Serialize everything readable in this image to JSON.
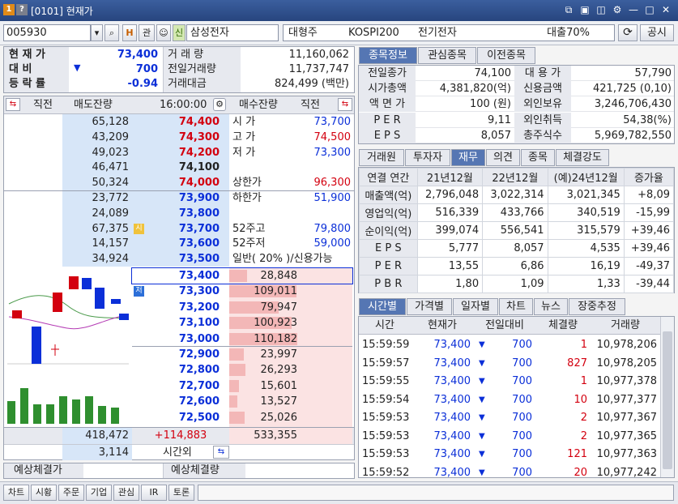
{
  "window": {
    "num1": "1",
    "num2": "?",
    "title": "[0101] 현재가"
  },
  "toolbar": {
    "code": "005930",
    "search_label": "⌕",
    "h_label": "H",
    "gwan_label": "관",
    "sin_label": "신",
    "stock_name": "삼성전자",
    "size_class": "대형주",
    "index": "KOSPI200",
    "sector": "전기전자",
    "loan": "대출70%",
    "refresh_label": "⟳",
    "notice_label": "공시"
  },
  "summary": {
    "rows": [
      {
        "label": "현 재 가",
        "value": "73,400"
      },
      {
        "label": "대    비",
        "arrow": "▼",
        "value": "700"
      },
      {
        "label": "등 락 률",
        "value": "-0.94"
      }
    ],
    "vol_rows": [
      {
        "label": "거 래 량",
        "value": "11,160,062"
      },
      {
        "label": "전일거래량",
        "value": "11,737,747"
      },
      {
        "label": "거래대금",
        "value": "824,499 (백만)"
      }
    ]
  },
  "orderbook": {
    "headers": {
      "prev": "직전",
      "ask": "매도잔량",
      "time": "16:00:00",
      "bid": "매수잔량",
      "prev2": "직전"
    },
    "asks": [
      {
        "qty": "65,128",
        "price": "74,400",
        "info_label": "시    가",
        "info_value": "73,700"
      },
      {
        "qty": "43,209",
        "price": "74,300",
        "info_label": "고    가",
        "info_value": "74,500"
      },
      {
        "qty": "49,023",
        "price": "74,200",
        "info_label": "저    가",
        "info_value": "73,300"
      },
      {
        "qty": "46,471",
        "price": "74,100",
        "info_label": "",
        "info_value": ""
      },
      {
        "qty": "50,324",
        "price": "74,000",
        "info_label": "상한가",
        "info_value": "96,300"
      },
      {
        "qty": "23,772",
        "price": "73,900",
        "info_label": "하한가",
        "info_value": "51,900"
      },
      {
        "qty": "24,089",
        "price": "73,800",
        "info_label": "",
        "info_value": ""
      },
      {
        "qty": "67,375",
        "price": "73,700",
        "info_label": "52주고",
        "info_value": "79,800",
        "tag": "시"
      },
      {
        "qty": "14,157",
        "price": "73,600",
        "info_label": "52주저",
        "info_value": "59,000"
      },
      {
        "qty": "34,924",
        "price": "73,500",
        "info_label": "일반( 20% )/신용가능",
        "info_value": ""
      }
    ],
    "bids": [
      {
        "price": "73,400",
        "qty": "28,848",
        "bar": 0.26
      },
      {
        "price": "73,300",
        "qty": "109,011",
        "bar": 0.99,
        "tag": "저"
      },
      {
        "price": "73,200",
        "qty": "79,947",
        "bar": 0.73
      },
      {
        "price": "73,100",
        "qty": "100,923",
        "bar": 0.92
      },
      {
        "price": "73,000",
        "qty": "110,182",
        "bar": 1.0
      },
      {
        "price": "72,900",
        "qty": "23,997",
        "bar": 0.22
      },
      {
        "price": "72,800",
        "qty": "26,293",
        "bar": 0.24
      },
      {
        "price": "72,700",
        "qty": "15,601",
        "bar": 0.14
      },
      {
        "price": "72,600",
        "qty": "13,527",
        "bar": 0.12
      },
      {
        "price": "72,500",
        "qty": "25,026",
        "bar": 0.23
      }
    ],
    "total_ask": "418,472",
    "diff": "+114,883",
    "total_bid": "533,355",
    "after_qty": "3,114",
    "after_label": "시간외",
    "expected_price_label": "예상체결가",
    "expected_qty_label": "예상체결량"
  },
  "bottom_buttons": [
    "차트",
    "시황",
    "주문",
    "기업",
    "관심",
    "IR",
    "토론"
  ],
  "info_tabs": [
    "종목정보",
    "관심종목",
    "이전종목"
  ],
  "stock_info": [
    {
      "l1": "전일종가",
      "v1": "74,100",
      "l2": "대 용 가",
      "v2": "57,790"
    },
    {
      "l1": "시가총액",
      "v1": "4,381,820(억)",
      "l2": "신용금액",
      "v2": "421,725  (0,10)"
    },
    {
      "l1": "액 면 가",
      "v1": "100 (원)",
      "l2": "외인보유",
      "v2": "3,246,706,430"
    },
    {
      "l1": "P E R",
      "v1": "9,11",
      "l2": "외인취득",
      "v2": "54,38(%)"
    },
    {
      "l1": "E P S",
      "v1": "8,057",
      "l2": "총주식수",
      "v2": "5,969,782,550"
    }
  ],
  "fin_tabs": [
    "거래원",
    "투자자",
    "재무",
    "의견",
    "종목",
    "체결강도"
  ],
  "fin_table": {
    "headers": [
      "연결 연간",
      "21년12월",
      "22년12월",
      "(예)24년12월",
      "증가율"
    ],
    "rows": [
      [
        "매출액(억)",
        "2,796,048",
        "3,022,314",
        "3,021,345",
        "+8,09"
      ],
      [
        "영업익(억)",
        "516,339",
        "433,766",
        "340,519",
        "-15,99"
      ],
      [
        "순이익(억)",
        "399,074",
        "556,541",
        "315,579",
        "+39,46"
      ],
      [
        "E P S",
        "5,777",
        "8,057",
        "4,535",
        "+39,46"
      ],
      [
        "P E R",
        "13,55",
        "6,86",
        "16,19",
        "-49,37"
      ],
      [
        "P B R",
        "1,80",
        "1,09",
        "1,33",
        "-39,44"
      ]
    ]
  },
  "trade_tabs": [
    "시간별",
    "가격별",
    "일자별",
    "차트",
    "뉴스",
    "장중추정"
  ],
  "trades": {
    "headers": [
      "시간",
      "현재가",
      "전일대비",
      "체결량",
      "거래량"
    ],
    "rows": [
      [
        "15:59:59",
        "73,400",
        "▼",
        "700",
        "1",
        "10,978,206"
      ],
      [
        "15:59:57",
        "73,400",
        "▼",
        "700",
        "827",
        "10,978,205"
      ],
      [
        "15:59:55",
        "73,400",
        "▼",
        "700",
        "1",
        "10,977,378"
      ],
      [
        "15:59:54",
        "73,400",
        "▼",
        "700",
        "10",
        "10,977,377"
      ],
      [
        "15:59:53",
        "73,400",
        "▼",
        "700",
        "2",
        "10,977,367"
      ],
      [
        "15:59:53",
        "73,400",
        "▼",
        "700",
        "2",
        "10,977,365"
      ],
      [
        "15:59:53",
        "73,400",
        "▼",
        "700",
        "121",
        "10,977,363"
      ],
      [
        "15:59:52",
        "73,400",
        "▼",
        "700",
        "20",
        "10,977,242"
      ]
    ]
  },
  "colors": {
    "up": "#d3000f",
    "down": "#0b2fd8",
    "ask_bg": "#d7e6f8",
    "bid_bg": "#fbe3e3",
    "accent": "#5576b3"
  }
}
